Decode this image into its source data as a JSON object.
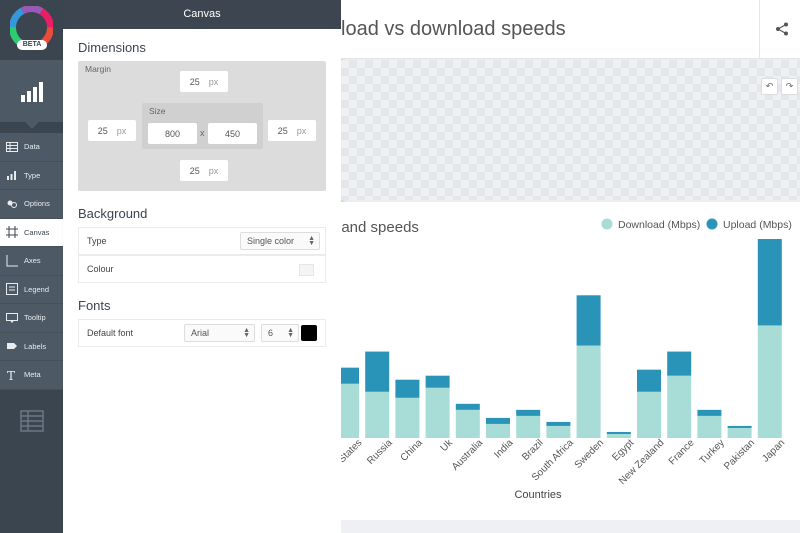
{
  "app": {
    "beta_label": "BETA"
  },
  "rail": {
    "items": [
      {
        "label": "Data",
        "icon": "table-icon"
      },
      {
        "label": "Type",
        "icon": "bar-chart-icon"
      },
      {
        "label": "Options",
        "icon": "options-icon"
      },
      {
        "label": "Canvas",
        "icon": "canvas-icon"
      },
      {
        "label": "Axes",
        "icon": "axes-icon"
      },
      {
        "label": "Legend",
        "icon": "legend-icon"
      },
      {
        "label": "Tooltip",
        "icon": "tooltip-icon"
      },
      {
        "label": "Labels",
        "icon": "labels-icon"
      },
      {
        "label": "Meta",
        "icon": "meta-icon"
      }
    ]
  },
  "panel": {
    "header": "Canvas",
    "dimensions": {
      "title": "Dimensions",
      "margin_label": "Margin",
      "size_label": "Size",
      "margin_top": "25",
      "margin_left": "25",
      "margin_right": "25",
      "margin_bottom": "25",
      "unit": "px",
      "width": "800",
      "height": "450",
      "times": "x"
    },
    "background": {
      "title": "Background",
      "type_label": "Type",
      "type_value": "Single color",
      "colour_label": "Colour",
      "colour_value": "#f4f4f4"
    },
    "fonts": {
      "title": "Fonts",
      "default_font_label": "Default font",
      "font_family": "Arial",
      "font_size": "6",
      "font_color": "#000000"
    }
  },
  "main": {
    "title": "load vs download speeds",
    "undo": "↶",
    "redo": "↷"
  },
  "colors": {
    "download": "#a8dcd7",
    "upload": "#2a93b8"
  },
  "chart_data": {
    "type": "bar",
    "stacked": true,
    "title": "band speeds",
    "xlabel": "Countries",
    "legend_position": "top-right",
    "categories": [
      "United States",
      "Russia",
      "China",
      "Uk",
      "Australia",
      "India",
      "Brazil",
      "South Africa",
      "Sweden",
      "Egypt",
      "New Zealand",
      "France",
      "Turkey",
      "Pakistan",
      "Japan"
    ],
    "series": [
      {
        "name": "Download (Mbps)",
        "values": [
          27,
          23,
          20,
          25,
          14,
          7,
          11,
          6,
          46,
          2,
          23,
          31,
          11,
          5,
          56
        ]
      },
      {
        "name": "Upload (Mbps)",
        "values": [
          8,
          20,
          9,
          6,
          3,
          3,
          3,
          2,
          25,
          1,
          11,
          12,
          3,
          1,
          43
        ]
      }
    ],
    "ylim": [
      0,
      100
    ]
  }
}
